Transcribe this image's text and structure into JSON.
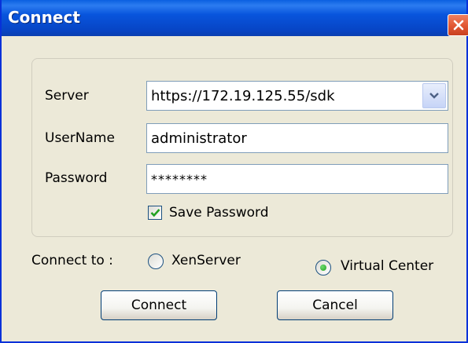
{
  "window": {
    "title": "Connect",
    "close_icon": "close-icon"
  },
  "form": {
    "server_label": "Server",
    "server_value": "https://172.19.125.55/sdk",
    "username_label": "UserName",
    "username_value": "administrator",
    "password_label": "Password",
    "password_value": "********",
    "save_password_label": "Save Password",
    "save_password_checked": true
  },
  "connect_to": {
    "label": "Connect to :",
    "options": [
      {
        "label": "XenServer",
        "selected": false
      },
      {
        "label": "Virtual Center",
        "selected": true
      }
    ]
  },
  "buttons": {
    "connect": "Connect",
    "cancel": "Cancel"
  },
  "colors": {
    "title_bar": "#0855dd",
    "window_background": "#ece9d8",
    "close_button": "#e35a36",
    "radio_selected": "#21a121",
    "checkbox_mark": "#21a121"
  }
}
